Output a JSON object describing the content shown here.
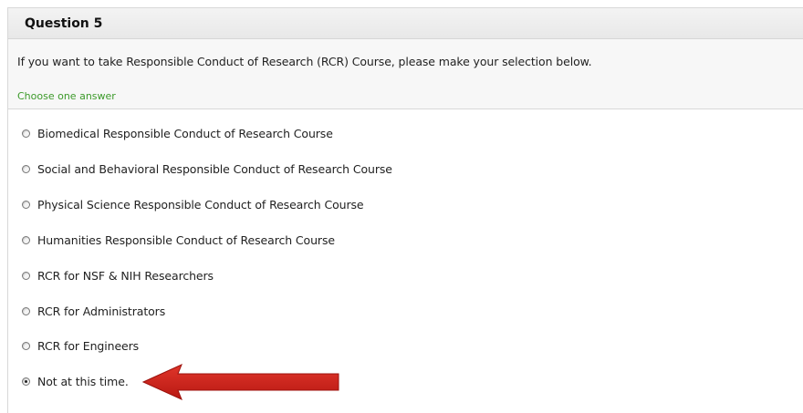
{
  "question": {
    "title": "Question 5",
    "prompt": "If you want to take Responsible Conduct of Research (RCR) Course, please make your selection below.",
    "hint": "Choose one answer",
    "options": [
      {
        "label": "Biomedical Responsible Conduct of Research Course",
        "selected": false
      },
      {
        "label": "Social and Behavioral Responsible Conduct of Research Course",
        "selected": false
      },
      {
        "label": "Physical Science Responsible Conduct of Research Course",
        "selected": false
      },
      {
        "label": "Humanities Responsible Conduct of Research Course",
        "selected": false
      },
      {
        "label": "RCR for NSF & NIH Researchers",
        "selected": false
      },
      {
        "label": "RCR for Administrators",
        "selected": false
      },
      {
        "label": "RCR for Engineers",
        "selected": false
      },
      {
        "label": "Not at this time.",
        "selected": true
      }
    ]
  },
  "colors": {
    "hint": "#3c9a2a",
    "arrow": "#d2231b"
  }
}
